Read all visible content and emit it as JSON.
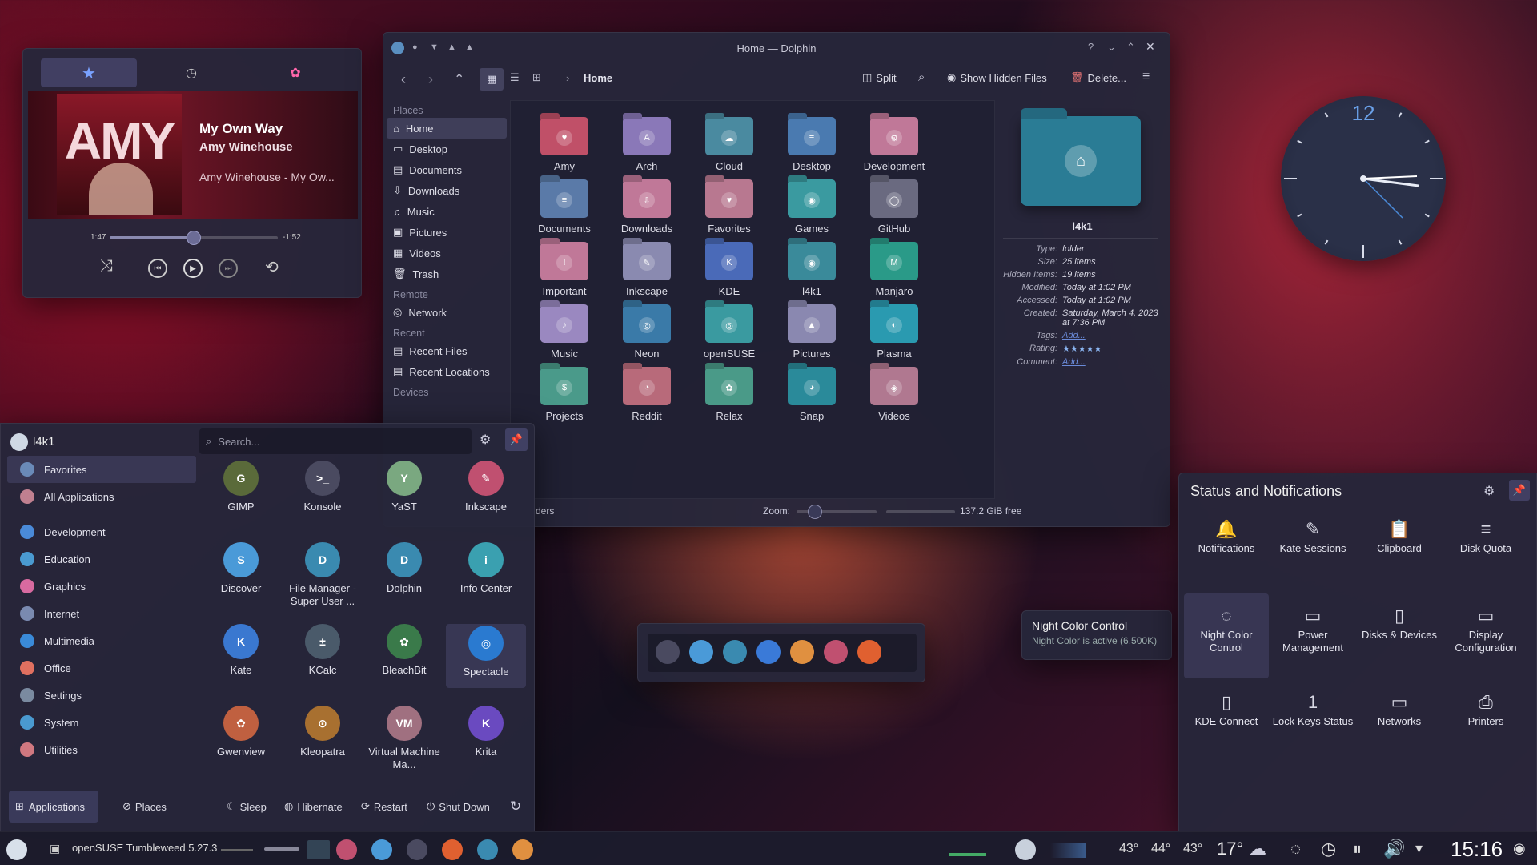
{
  "player": {
    "tabs": [
      "favorites-icon",
      "recent-icon",
      "photos-icon"
    ],
    "album_text": "AMY",
    "track_title": "My Own Way",
    "artist": "Amy Winehouse",
    "album": "Amy Winehouse - My Ow...",
    "time_elapsed": "1:47",
    "time_remaining": "-1:52",
    "progress": 0.5
  },
  "dolphin": {
    "title": "Home — Dolphin",
    "breadcrumb": "Home",
    "split_label": "Split",
    "hidden_label": "Show Hidden Files",
    "delete_label": "Delete...",
    "places_head": "Places",
    "remote_head": "Remote",
    "recent_head": "Recent",
    "devices_head": "Devices",
    "places": [
      "Home",
      "Desktop",
      "Documents",
      "Downloads",
      "Music",
      "Pictures",
      "Videos",
      "Trash"
    ],
    "remote": [
      "Network"
    ],
    "recent": [
      "Recent Files",
      "Recent Locations"
    ],
    "folders": [
      "Amy",
      "Arch",
      "Cloud",
      "Desktop",
      "Development",
      "Documents",
      "Downloads",
      "Favorites",
      "Games",
      "GitHub",
      "Important",
      "Inkscape",
      "KDE",
      "l4k1",
      "Manjaro",
      "Music",
      "Neon",
      "openSUSE",
      "Pictures",
      "Plasma",
      "Projects",
      "Reddit",
      "Relax",
      "Snap",
      "Videos"
    ],
    "status_left": "ders",
    "zoom_label": "Zoom:",
    "free_space": "137.2 GiB free",
    "info": {
      "name": "l4k1",
      "type_k": "Type:",
      "type_v": "folder",
      "size_k": "Size:",
      "size_v": "25 items",
      "hidden_k": "Hidden Items:",
      "hidden_v": "19 items",
      "mod_k": "Modified:",
      "mod_v": "Today at 1:02 PM",
      "acc_k": "Accessed:",
      "acc_v": "Today at 1:02 PM",
      "cre_k": "Created:",
      "cre_v": "Saturday, March 4, 2023 at 7:36 PM",
      "tags_k": "Tags:",
      "tags_v": "Add...",
      "rating_k": "Rating:",
      "rating_v": "★★★★★",
      "comment_k": "Comment:",
      "comment_v": "Add..."
    }
  },
  "clock": {
    "twelve": "12"
  },
  "launcher": {
    "user": "l4k1",
    "search_placeholder": "Search...",
    "categories": [
      "Favorites",
      "All Applications",
      "Development",
      "Education",
      "Graphics",
      "Internet",
      "Multimedia",
      "Office",
      "Settings",
      "System",
      "Utilities"
    ],
    "apps": [
      "GIMP",
      "Konsole",
      "YaST",
      "Inkscape",
      "Discover",
      "File Manager - Super User ...",
      "Dolphin",
      "Info Center",
      "Kate",
      "KCalc",
      "BleachBit",
      "Spectacle",
      "Gwenview",
      "Kleopatra",
      "Virtual Machine Ma...",
      "Krita"
    ],
    "bottom": {
      "applications": "Applications",
      "places": "Places",
      "sleep": "Sleep",
      "hibernate": "Hibernate",
      "restart": "Restart",
      "shutdown": "Shut Down"
    }
  },
  "status": {
    "title": "Status and Notifications",
    "items": [
      "Notifications",
      "Kate Sessions",
      "Clipboard",
      "Disk Quota",
      "Night Color Control",
      "Power Management",
      "Disks & Devices",
      "Display Configuration",
      "KDE Connect",
      "Lock Keys Status",
      "Networks",
      "Printers"
    ]
  },
  "tooltip": {
    "title": "Night Color Control",
    "text": "Night Color is active (6,500K)"
  },
  "taskbar": {
    "window_title": "openSUSE Tumbleweed 5.27.3",
    "temps": [
      "43°",
      "44°",
      "43°"
    ],
    "weather": "17°",
    "time": "15:16"
  }
}
